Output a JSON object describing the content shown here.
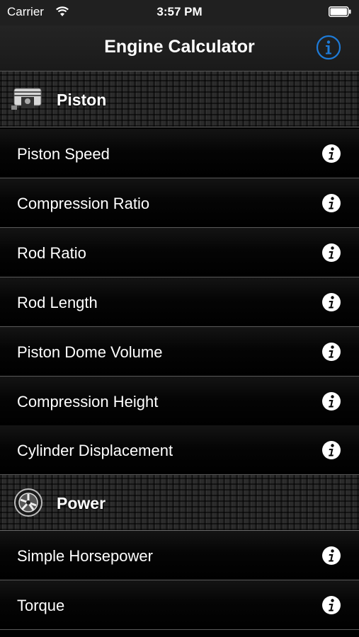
{
  "status_bar": {
    "carrier": "Carrier",
    "time": "3:57 PM"
  },
  "nav": {
    "title": "Engine Calculator"
  },
  "colors": {
    "accent": "#1e7bd8",
    "row_divider": "#5a5a5a"
  },
  "sections": [
    {
      "label": "Piston",
      "icon": "piston-icon",
      "items": [
        {
          "label": "Piston Speed"
        },
        {
          "label": "Compression Ratio"
        },
        {
          "label": "Rod Ratio"
        },
        {
          "label": "Rod Length"
        },
        {
          "label": "Piston Dome Volume"
        },
        {
          "label": "Compression Height"
        },
        {
          "label": "Cylinder Displacement"
        }
      ]
    },
    {
      "label": "Power",
      "icon": "wheel-icon",
      "items": [
        {
          "label": "Simple Horsepower"
        },
        {
          "label": "Torque"
        }
      ]
    }
  ]
}
